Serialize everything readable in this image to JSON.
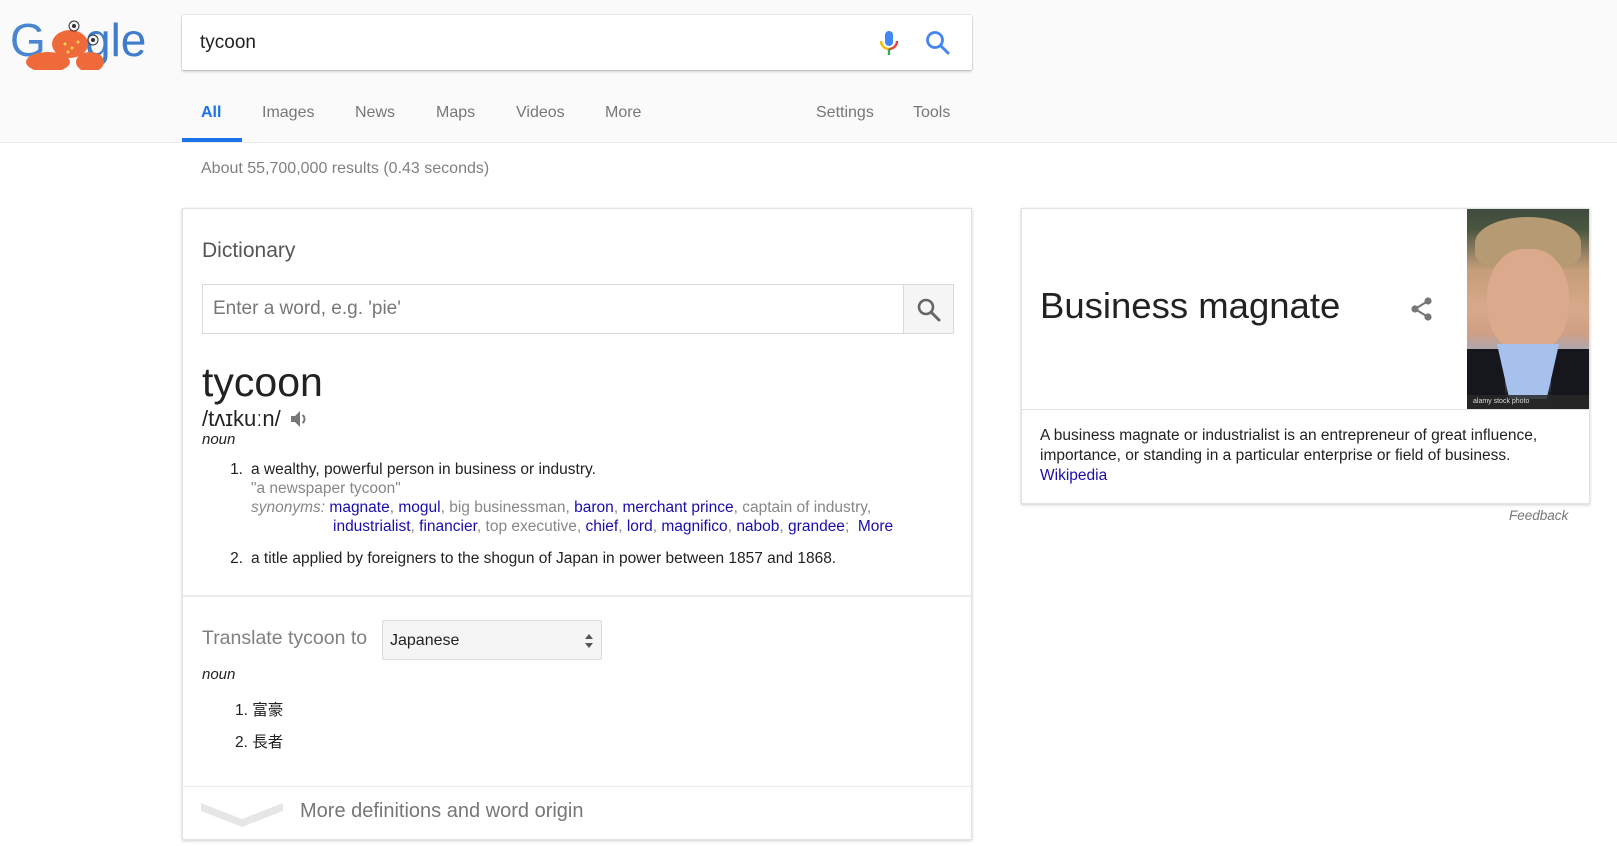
{
  "header": {
    "logo_alt": "Google doodle",
    "search_query": "tycoon",
    "tabs": [
      {
        "label": "All",
        "active": true
      },
      {
        "label": "Images"
      },
      {
        "label": "News"
      },
      {
        "label": "Maps"
      },
      {
        "label": "Videos"
      },
      {
        "label": "More"
      }
    ],
    "tools": [
      {
        "label": "Settings"
      },
      {
        "label": "Tools"
      }
    ]
  },
  "result_stats": "About 55,700,000 results (0.43 seconds)",
  "dictionary": {
    "title": "Dictionary",
    "search_placeholder": "Enter a word, e.g. 'pie'",
    "word": "tycoon",
    "phonetic": "/tʌɪkuːn/",
    "part_of_speech": "noun",
    "definitions": [
      {
        "num": "1.",
        "text": "a wealthy, powerful person in business or industry.",
        "example": "\"a newspaper tycoon\"",
        "synonyms_label": "synonyms:",
        "synonyms_line1": [
          {
            "word": "magnate",
            "link": true
          },
          {
            "word": "mogul",
            "link": true
          },
          {
            "word": "big businessman",
            "link": false
          },
          {
            "word": "baron",
            "link": true
          },
          {
            "word": "merchant prince",
            "link": true
          },
          {
            "word": "captain of industry",
            "link": false
          }
        ],
        "synonyms_line2": [
          {
            "word": "industrialist",
            "link": true
          },
          {
            "word": "financier",
            "link": true
          },
          {
            "word": "top executive",
            "link": false
          },
          {
            "word": "chief",
            "link": true
          },
          {
            "word": "lord",
            "link": true
          },
          {
            "word": "magnifico",
            "link": true
          },
          {
            "word": "nabob",
            "link": true
          },
          {
            "word": "grandee",
            "link": true
          }
        ],
        "more_label": "More"
      },
      {
        "num": "2.",
        "text": "a title applied by foreigners to the shogun of Japan in power between 1857 and 1868."
      }
    ],
    "translate": {
      "label": "Translate tycoon to",
      "selected_language": "Japanese",
      "part_of_speech": "noun",
      "items": [
        {
          "num": "1.",
          "text": "富豪"
        },
        {
          "num": "2.",
          "text": "長者"
        }
      ]
    },
    "more_definitions": "More definitions and word origin"
  },
  "knowledge_panel": {
    "title": "Business magnate",
    "image_caption": "alamy stock photo",
    "description": "A business magnate or industrialist is an entrepreneur of great influence, importance, or standing in a particular enterprise or field of business.",
    "source_link": "Wikipedia",
    "feedback": "Feedback"
  },
  "colors": {
    "accent_blue": "#1a73e8",
    "link_blue": "#1a0dab",
    "muted_gray": "#878787"
  }
}
